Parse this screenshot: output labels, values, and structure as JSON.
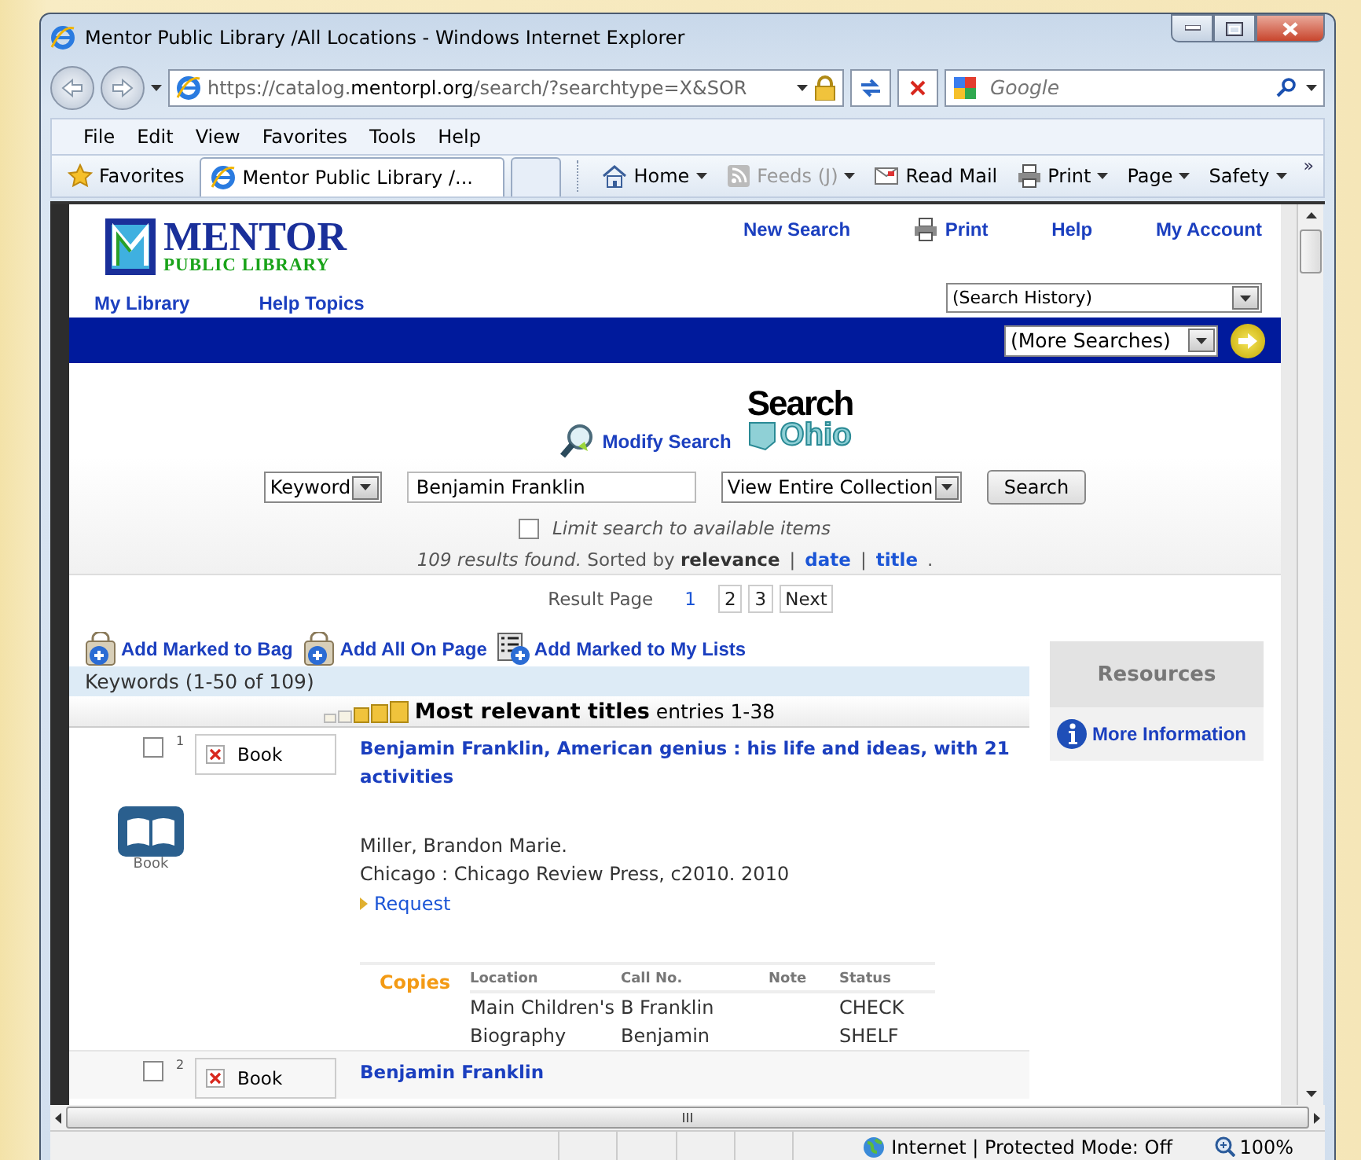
{
  "window": {
    "title": "Mentor Public Library /All Locations - Windows Internet Explorer"
  },
  "address_bar": {
    "url_host": "https://catalog.",
    "url_domain": "mentorpl.org",
    "url_path": "/search/?searchtype=X&SOR"
  },
  "search_box": {
    "placeholder": "Google"
  },
  "menu_bar": [
    "File",
    "Edit",
    "View",
    "Favorites",
    "Tools",
    "Help"
  ],
  "favorites_bar": {
    "favorites": "Favorites",
    "tabs": [
      {
        "label": "Mentor Public Library /...",
        "selected": true
      },
      {
        "selected": false
      }
    ],
    "commands": [
      {
        "label": "Home",
        "kind": "home",
        "disabled": false,
        "menu": true
      },
      {
        "label": "Feeds (J)",
        "kind": "feeds",
        "disabled": true,
        "menu": true
      },
      {
        "label": "Read Mail",
        "kind": "mail",
        "disabled": false,
        "menu": false
      },
      {
        "label": "Print",
        "kind": "print",
        "disabled": false,
        "menu": true
      },
      {
        "label": "Page",
        "kind": "plain",
        "disabled": false,
        "menu": true
      },
      {
        "label": "Safety",
        "kind": "plain",
        "disabled": false,
        "menu": true
      }
    ],
    "more": "»"
  },
  "page": {
    "logo": {
      "name": "MENTOR",
      "subtitle": "PUBLIC LIBRARY"
    },
    "top_links": [
      {
        "label": "New Search",
        "kind": "text"
      },
      {
        "label": "Print",
        "kind": "print"
      },
      {
        "label": "Help",
        "kind": "text"
      },
      {
        "label": "My Account",
        "kind": "text"
      }
    ],
    "nav_links": [
      "My Library",
      "Help Topics"
    ],
    "search_history": "(Search History)",
    "more_searches": "(More Searches)",
    "search_form": {
      "modify": "Modify Search",
      "ohio_logo": {
        "top": "Search",
        "bottom": "Ohio"
      },
      "type": "Keyword",
      "query": "Benjamin Franklin",
      "scope": "View Entire Collection",
      "button": "Search",
      "limit": {
        "label": "Limit search to available items",
        "checked": false
      }
    },
    "summary": {
      "found": "109 results found.",
      "sorted": "Sorted by **relevance**",
      "separator": "|",
      "links": [
        "date",
        "title"
      ],
      "end": "."
    },
    "pagination": {
      "label": "Result Page",
      "pages": [
        {
          "label": "1",
          "selected": true
        },
        {
          "label": "2",
          "selected": false
        },
        {
          "label": "3",
          "selected": false
        }
      ],
      "next": "Next"
    },
    "actions": [
      {
        "label": "Add Marked to Bag",
        "kind": "bag"
      },
      {
        "label": "Add All On Page",
        "kind": "bag"
      },
      {
        "label": "Add Marked to My Lists",
        "kind": "list"
      }
    ],
    "keywords_header": "Keywords (1-50 of 109)",
    "group": {
      "title": "Most relevant titles",
      "entries": "entries 1-38",
      "stars": 3
    },
    "records": [
      {
        "number": "1",
        "checked": false,
        "format": "Book",
        "title": "Benjamin Franklin, American genius : his life and ideas, with 21 activities",
        "icon_label": "Book",
        "author": "Miller, Brandon Marie.",
        "publisher": "Chicago : Chicago Review Press, c2010. 2010",
        "request": "Request",
        "copies": {
          "label": "Copies",
          "columns": [
            "Location",
            "Call No.",
            "Note",
            "Status"
          ],
          "rows": [
            {
              "location": " Main Children's Biography",
              "call_no": "B Franklin Benjamin",
              "status": " CHECK SHELF"
            }
          ]
        }
      },
      {
        "number": "2",
        "checked": false,
        "format": "Book",
        "title": "Benjamin Franklin"
      }
    ],
    "resources": {
      "title": "Resources",
      "links": [
        "More Information"
      ]
    }
  },
  "status_bar": {
    "zone": "Internet | Protected Mode: Off",
    "zoom": "100%"
  }
}
